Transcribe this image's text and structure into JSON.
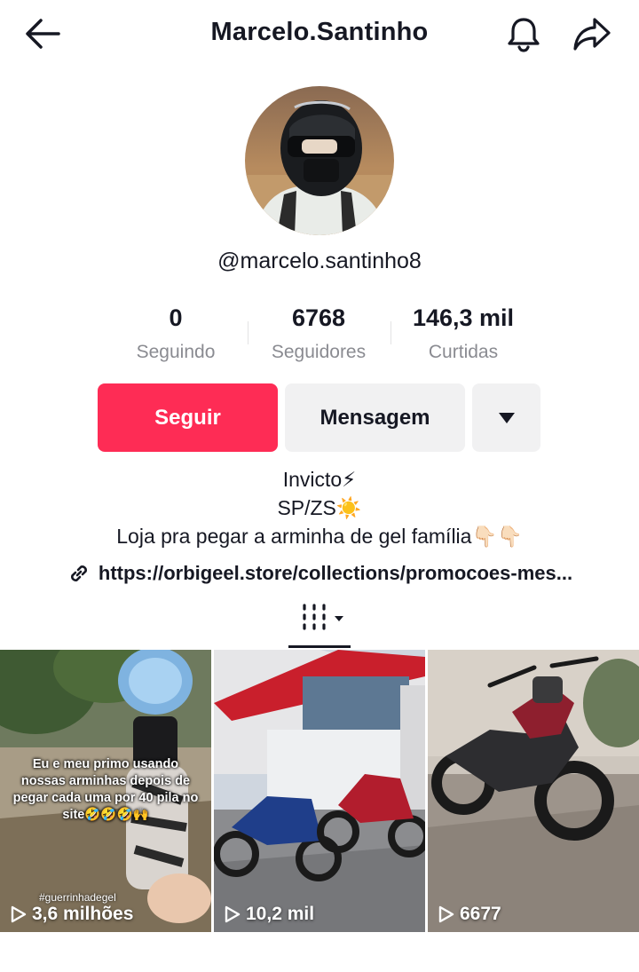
{
  "header": {
    "username": "Marcelo.Santinho",
    "back_icon": "arrow-left-icon",
    "bell_icon": "bell-icon",
    "share_icon": "share-icon"
  },
  "profile": {
    "handle": "@marcelo.santinho8",
    "avatar_alt": "rider in black helmet"
  },
  "stats": [
    {
      "value": "0",
      "label": "Seguindo"
    },
    {
      "value": "6768",
      "label": "Seguidores"
    },
    {
      "value": "146,3 mil",
      "label": "Curtidas"
    }
  ],
  "actions": {
    "follow_label": "Seguir",
    "message_label": "Mensagem",
    "more_icon": "caret-down-icon"
  },
  "bio": {
    "line1": "Invicto⚡",
    "line2": "SP/ZS☀️",
    "line3": "Loja pra pegar a arminha de gel família👇🏻👇🏻"
  },
  "link": {
    "icon": "link-icon",
    "url": "https://orbigeel.store/collections/promocoes-mes..."
  },
  "tabs": {
    "grid_icon": "videos-grid-icon"
  },
  "colors": {
    "accent": "#fe2c55",
    "secondary_button": "#f1f1f2",
    "muted_text": "#8a8b91"
  },
  "videos": [
    {
      "views": "3,6 milhões",
      "caption": "Eu e meu primo usando nossas arminhas depois de pegar cada uma por 40 pila no site🤣🤣🤣🙌",
      "hashtag": "#guerrinhadegel"
    },
    {
      "views": "10,2 mil"
    },
    {
      "views": "6677"
    }
  ]
}
